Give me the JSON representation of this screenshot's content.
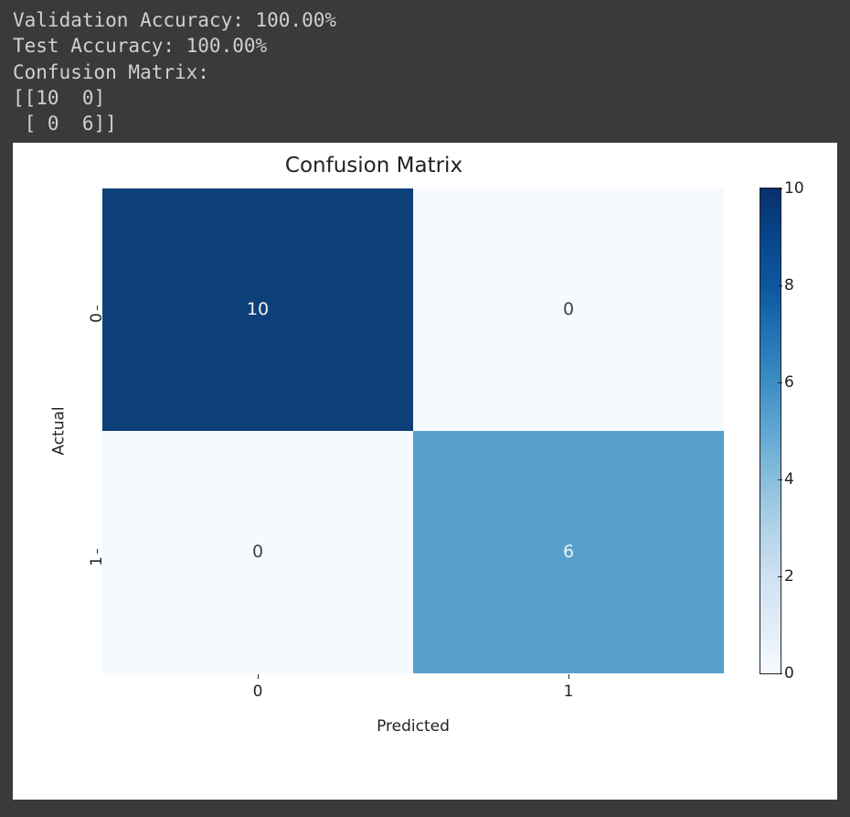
{
  "console": {
    "line1": "Validation Accuracy: 100.00%",
    "line2": "Test Accuracy: 100.00%",
    "line3": "Confusion Matrix:",
    "line4": "[[10  0]",
    "line5": " [ 0  6]]"
  },
  "chart_data": {
    "type": "heatmap",
    "title": "Confusion Matrix",
    "xlabel": "Predicted",
    "ylabel": "Actual",
    "x_categories": [
      "0",
      "1"
    ],
    "y_categories": [
      "0",
      "1"
    ],
    "values": [
      [
        10,
        0
      ],
      [
        0,
        6
      ]
    ],
    "colorbar": {
      "min": 0,
      "max": 10,
      "ticks": [
        0,
        2,
        4,
        6,
        8,
        10
      ]
    },
    "colormap": "Blues"
  },
  "cells": {
    "c00": "10",
    "c01": "0",
    "c10": "0",
    "c11": "6"
  },
  "ticks": {
    "x0": "0",
    "x1": "1",
    "y0": "0",
    "y1": "1",
    "cb0": "0",
    "cb2": "2",
    "cb4": "4",
    "cb6": "6",
    "cb8": "8",
    "cb10": "10"
  }
}
